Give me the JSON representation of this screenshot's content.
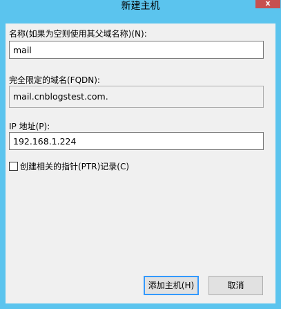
{
  "window": {
    "title": "新建主机",
    "close_label": "x"
  },
  "form": {
    "name": {
      "label": "名称(如果为空则使用其父域名称)(N):",
      "value": "mail"
    },
    "fqdn": {
      "label": "完全限定的域名(FQDN):",
      "value": "mail.cnblogstest.com."
    },
    "ip": {
      "label": "IP 地址(P):",
      "value": "192.168.1.224"
    },
    "ptr": {
      "label": "创建相关的指针(PTR)记录(C)",
      "checked": false
    }
  },
  "buttons": {
    "add": "添加主机(H)",
    "cancel": "取消"
  },
  "colors": {
    "frame": "#5bc4ee",
    "client": "#f0f0f0",
    "close": "#c75050",
    "focus": "#3399ff"
  }
}
